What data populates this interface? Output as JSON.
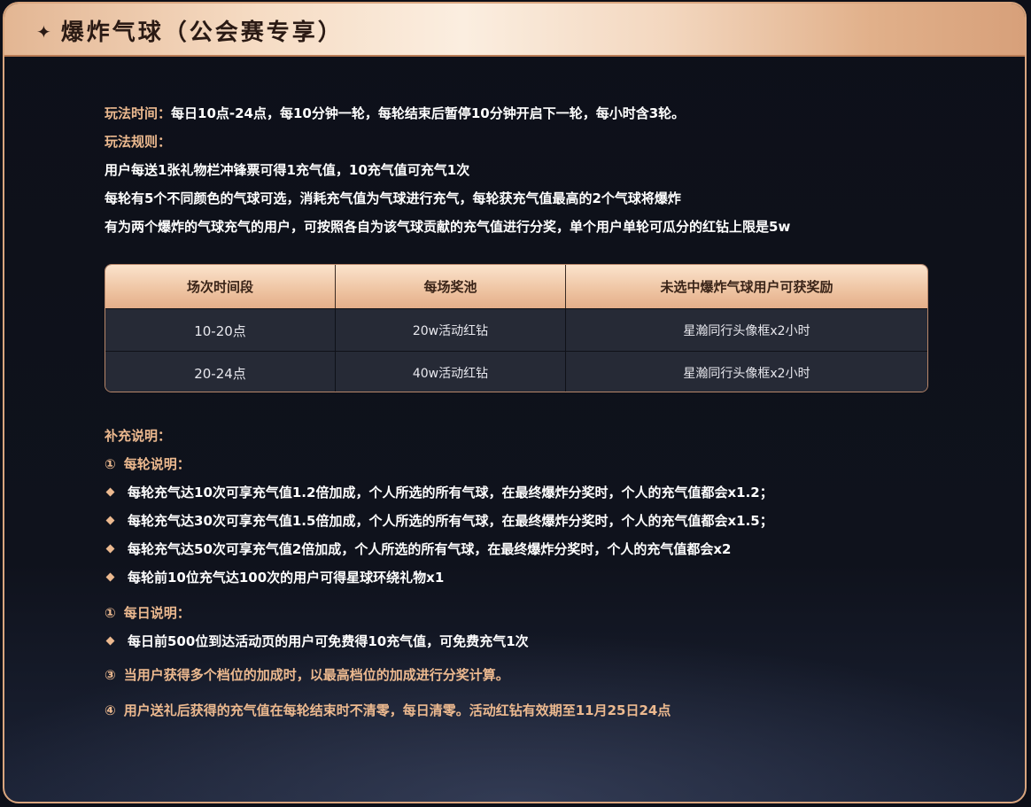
{
  "header": {
    "star_icon": "✦",
    "title": "爆炸气球（公会赛专享）"
  },
  "intro": {
    "time_label": "玩法时间：",
    "time_text": "每日10点-24点，每10分钟一轮，每轮结束后暂停10分钟开启下一轮，每小时含3轮。",
    "rules_label": "玩法规则：",
    "rules": [
      "用户每送1张礼物栏冲锋票可得1充气值，10充气值可充气1次",
      "每轮有5个不同颜色的气球可选，消耗充气值为气球进行充气，每轮获充气值最高的2个气球将爆炸",
      "有为两个爆炸的气球充气的用户，可按照各自为该气球贡献的充气值进行分奖，单个用户单轮可瓜分的红钻上限是5w"
    ]
  },
  "table": {
    "headers": [
      "场次时间段",
      "每场奖池",
      "未选中爆炸气球用户可获奖励"
    ],
    "rows": [
      [
        "10-20点",
        "20w活动红钻",
        "星瀚同行头像框x2小时"
      ],
      [
        "20-24点",
        "40w活动红钻",
        "星瀚同行头像框x2小时"
      ]
    ]
  },
  "notes": {
    "label": "补充说明：",
    "per_round_label": "每轮说明：",
    "per_round_marker": "①",
    "per_round_items": [
      "每轮充气达10次可享充气值1.2倍加成，个人所选的所有气球，在最终爆炸分奖时，个人的充气值都会x1.2；",
      "每轮充气达30次可享充气值1.5倍加成，个人所选的所有气球，在最终爆炸分奖时，个人的充气值都会x1.5；",
      "每轮充气达50次可享充气值2倍加成，个人所选的所有气球，在最终爆炸分奖时，个人的充气值都会x2",
      "每轮前10位充气达100次的用户可得星球环绕礼物x1"
    ],
    "daily_label": "每日说明：",
    "daily_marker": "①",
    "daily_items": [
      "每日前500位到达活动页的用户可免费得10充气值，可免费充气1次"
    ],
    "note3_marker": "③",
    "note3": "当用户获得多个档位的加成时，以最高档位的加成进行分奖计算。",
    "note4_marker": "④",
    "note4": "用户送礼后获得的充气值在每轮结束时不清零，每日清零。活动红钻有效期至11月25日24点"
  }
}
